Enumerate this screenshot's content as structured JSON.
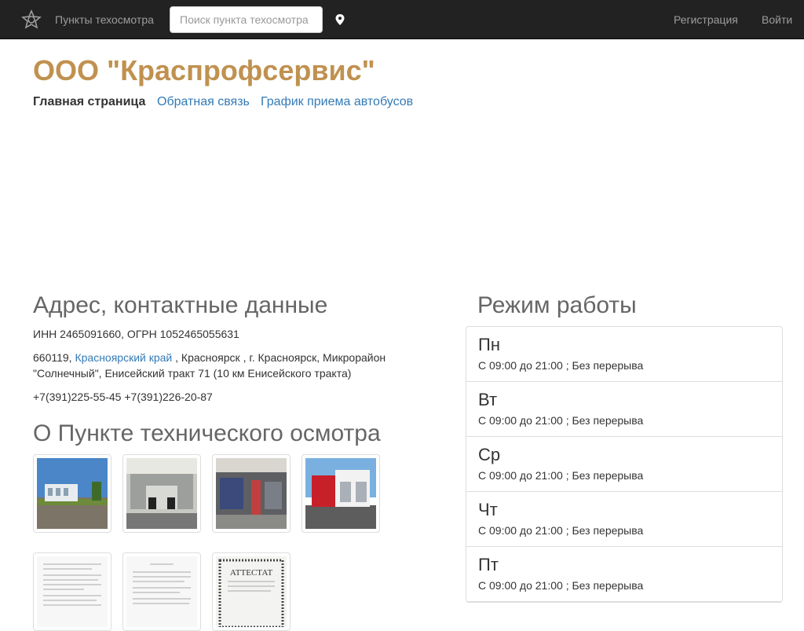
{
  "nav": {
    "brand_link": "Пункты техосмотра",
    "search_placeholder": "Поиск пункта техосмотра",
    "register": "Регистрация",
    "login": "Войти"
  },
  "header": {
    "title": "ООО \"Краспрофсервис\"",
    "tabs": [
      "Главная страница",
      "Обратная связь",
      "График приема автобусов"
    ]
  },
  "contacts": {
    "heading": "Адрес, контактные данные",
    "ids": "ИНН 2465091660, ОГРН 1052465055631",
    "postcode": "660119,",
    "region": "Красноярский край",
    "address_rest": ", Красноярск , г. Красноярск, Микрорайон \"Солнечный\", Енисейский тракт 71 (10 км Енисейского тракта)",
    "phones": "+7(391)225-55-45 +7(391)226-20-87"
  },
  "about": {
    "heading": "О Пункте технического осмотра",
    "certificate_text": "АТТЕСТАТ"
  },
  "schedule": {
    "heading": "Режим работы",
    "days": [
      {
        "name": "Пн",
        "hours": "С 09:00 до 21:00 ; Без перерыва"
      },
      {
        "name": "Вт",
        "hours": "С 09:00 до 21:00 ; Без перерыва"
      },
      {
        "name": "Ср",
        "hours": "С 09:00 до 21:00 ; Без перерыва"
      },
      {
        "name": "Чт",
        "hours": "С 09:00 до 21:00 ; Без перерыва"
      },
      {
        "name": "Пт",
        "hours": "С 09:00 до 21:00 ; Без перерыва"
      }
    ]
  },
  "colors": {
    "navbar": "#222222",
    "title": "#c0914f",
    "link": "#337ab7"
  },
  "icons": [
    "logo-icon",
    "map-pin-icon"
  ]
}
